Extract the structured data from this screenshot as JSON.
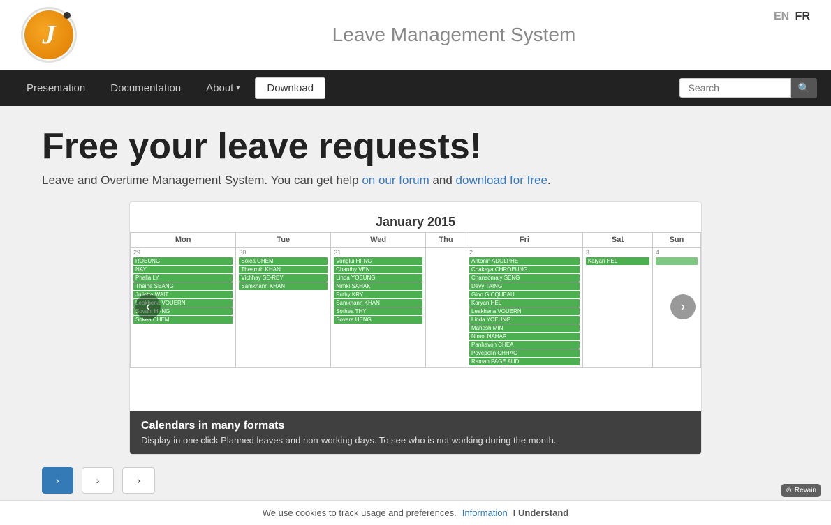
{
  "header": {
    "site_title": "Leave Management System",
    "lang_en": "EN",
    "lang_fr": "FR",
    "logo_letter": "J"
  },
  "navbar": {
    "items": [
      {
        "label": "Presentation",
        "name": "presentation"
      },
      {
        "label": "Documentation",
        "name": "documentation"
      },
      {
        "label": "About",
        "name": "about"
      },
      {
        "label": "Download",
        "name": "download"
      }
    ],
    "search_placeholder": "Search",
    "search_button_icon": "🔍"
  },
  "hero": {
    "title": "Free your leave requests!",
    "subtitle_start": "Leave and Overtime Management System. You can get help ",
    "link1_text": "on our forum",
    "subtitle_mid": " and ",
    "link2_text": "download for free",
    "subtitle_end": "."
  },
  "calendar": {
    "month_title": "January 2015",
    "headers": [
      "Mon",
      "Tue",
      "Wed",
      "Thu",
      "Fri",
      "Sat",
      "Sun"
    ],
    "caption_title": "Calendars in many formats",
    "caption_text": "Display in one click Planned leaves and non-working days. To see who is not working during the month."
  },
  "actions": {
    "btn1": "›",
    "btn2": "›",
    "btn3": "›"
  },
  "cookie": {
    "text": "We use cookies to track usage and preferences.",
    "info_link": "Information",
    "understand_btn": "I Understand"
  },
  "revain": {
    "label": "Revain"
  }
}
